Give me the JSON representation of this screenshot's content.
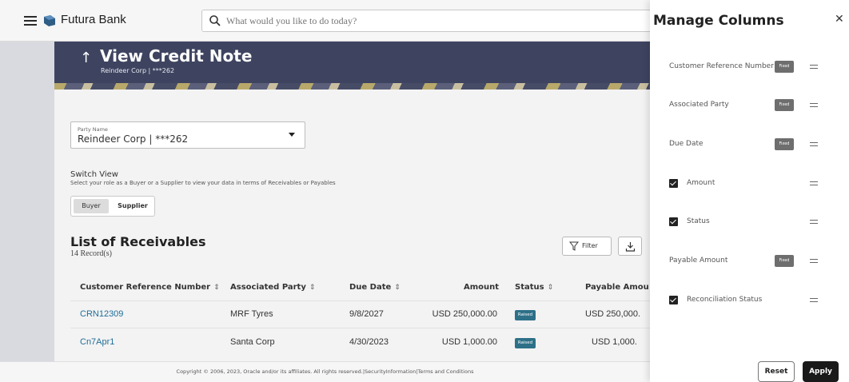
{
  "header": {
    "bank_name": "Futura Bank",
    "search_placeholder": "What would you like to do today?",
    "icons": [
      "hamburger-menu-icon",
      "bank-logo-icon",
      "search-icon"
    ]
  },
  "banner": {
    "title": "View Credit Note",
    "subtitle": "Reindeer Corp | ***262"
  },
  "form": {
    "party_label": "Party Name",
    "party_value": "Reindeer Corp | ***262"
  },
  "switch_view": {
    "title": "Switch View",
    "description": "Select your role as a Buyer or a Supplier to view your data in terms of Receivables or Payables",
    "buyer_label": "Buyer",
    "supplier_label": "Supplier",
    "selected": "Buyer"
  },
  "list": {
    "title": "List of Receivables",
    "record_count": "14 Record(s)",
    "filter_label": "Filter",
    "columns": [
      "Customer Reference Number",
      "Associated Party",
      "Due Date",
      "Amount",
      "Status",
      "Payable Amou"
    ],
    "rows": [
      {
        "ref": "CRN12309",
        "party": "MRF Tyres",
        "due": "9/8/2027",
        "amount": "USD 250,000.00",
        "status": "Raised",
        "payable": "USD 250,000."
      },
      {
        "ref": "Cn7Apr1",
        "party": "Santa Corp",
        "due": "4/30/2023",
        "amount": "USD 1,000.00",
        "status": "Raised",
        "payable": "USD 1,000."
      }
    ]
  },
  "footer": {
    "text": "Copyright © 2006, 2023, Oracle and/or its affiliates. All rights reserved.|SecurityInformation|Terms and Conditions"
  },
  "panel": {
    "title": "Manage Columns",
    "fixed_label": "Fixed",
    "items": [
      {
        "label": "Customer Reference Number",
        "fixed": true
      },
      {
        "label": "Associated Party",
        "fixed": true
      },
      {
        "label": "Due Date",
        "fixed": true
      },
      {
        "label": "Amount",
        "fixed": false,
        "checked": true
      },
      {
        "label": "Status",
        "fixed": false,
        "checked": true
      },
      {
        "label": "Payable Amount",
        "fixed": true
      },
      {
        "label": "Reconciliation Status",
        "fixed": false,
        "checked": true
      }
    ],
    "reset_label": "Reset",
    "apply_label": "Apply"
  },
  "colors": {
    "banner": "#3e4460",
    "status_badge": "#2d7088",
    "link": "#1f6e9a",
    "apply_button": "#1a1a1a"
  }
}
